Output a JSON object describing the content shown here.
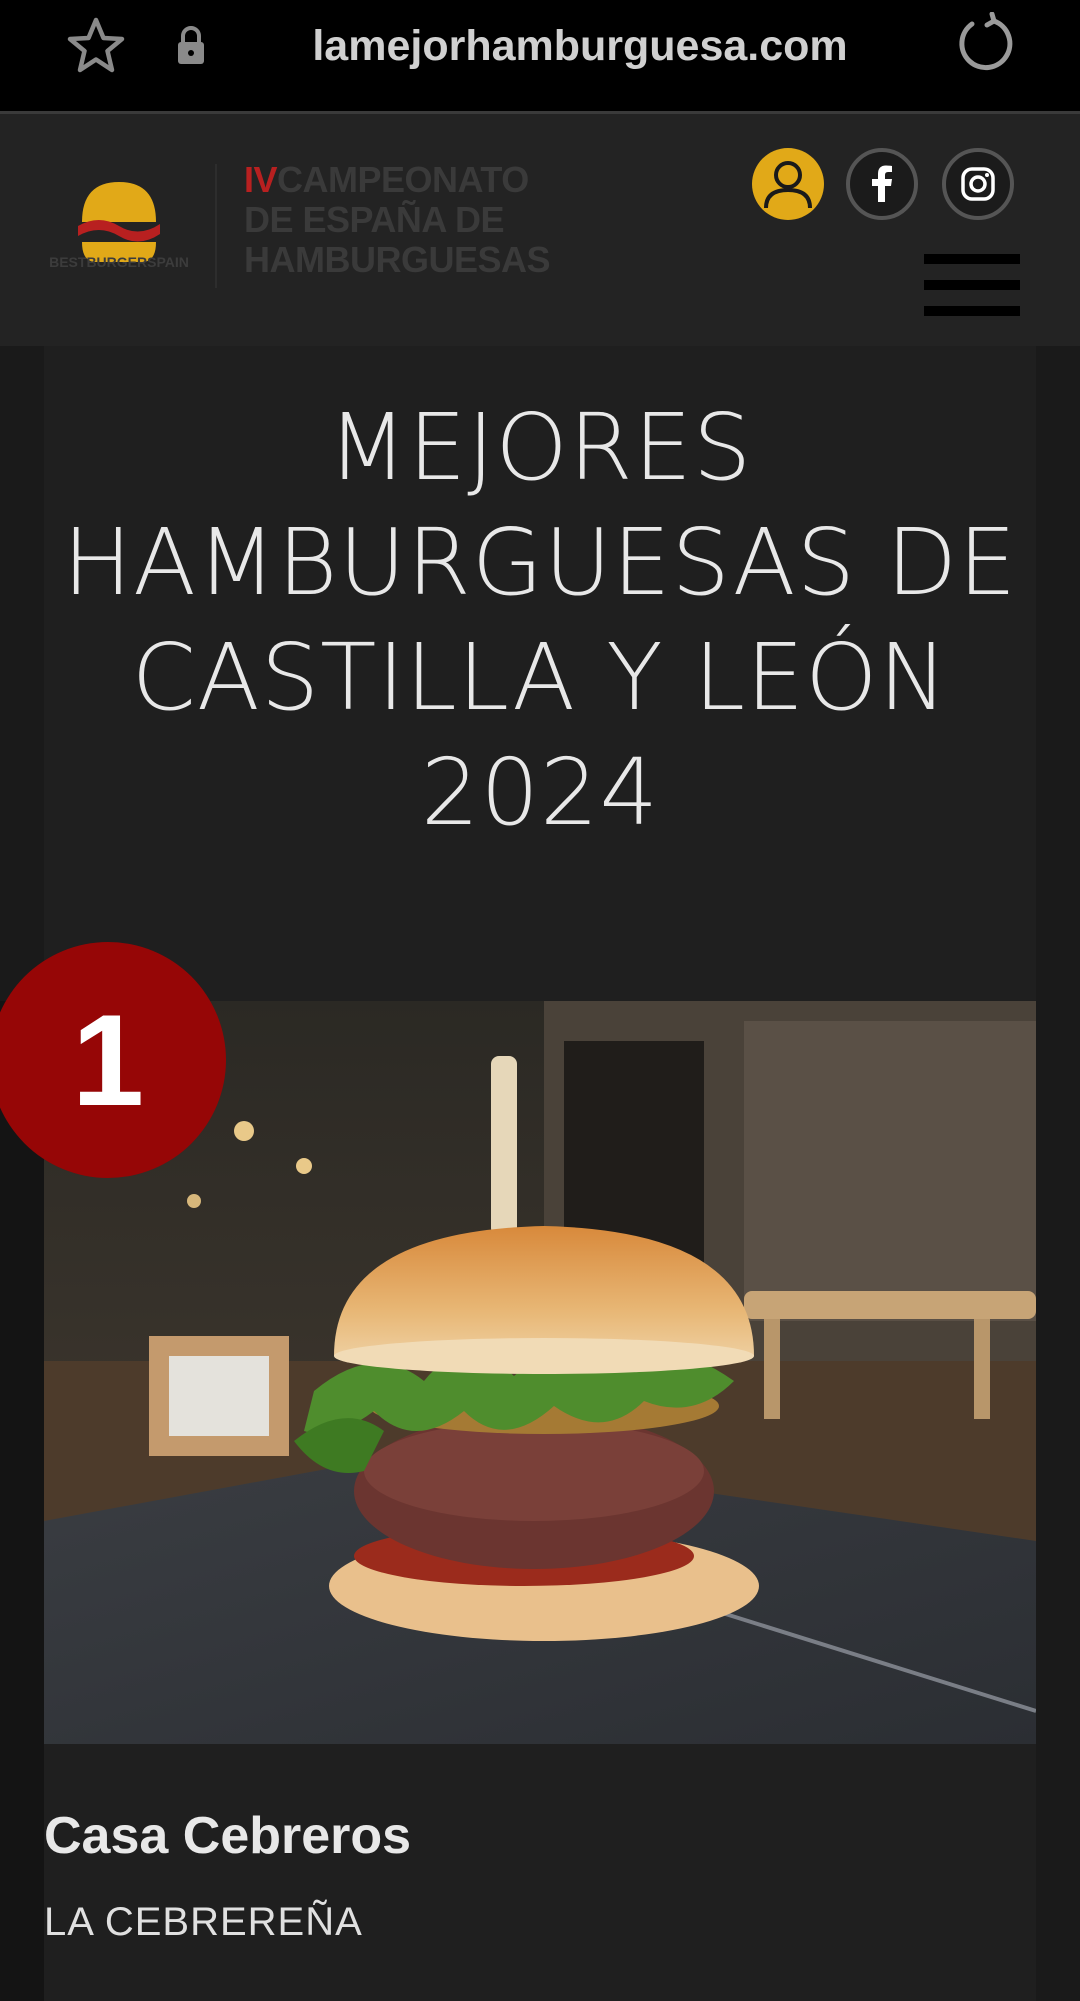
{
  "browser": {
    "url": "lamejorhamburguesa.com"
  },
  "header": {
    "logo_caption": "BESTBURGERSPAIN",
    "championship_roman": "IV",
    "championship_line1": "CAMPEONATO",
    "championship_line2": "DE ESPAÑA DE",
    "championship_line3": "HAMBURGUESAS"
  },
  "main": {
    "title": "MEJORES HAMBURGUESAS DE CASTILLA Y LEÓN 2024",
    "entries": [
      {
        "rank": "1",
        "restaurant": "Casa Cebreros",
        "burger": "LA CEBREREÑA"
      }
    ]
  },
  "colors": {
    "accent_gold": "#e1a918",
    "badge_red": "#960606",
    "logo_red": "#b82020"
  },
  "icons": [
    "star-icon",
    "lock-icon",
    "reload-icon",
    "user-icon",
    "facebook-icon",
    "instagram-icon",
    "menu-icon"
  ]
}
